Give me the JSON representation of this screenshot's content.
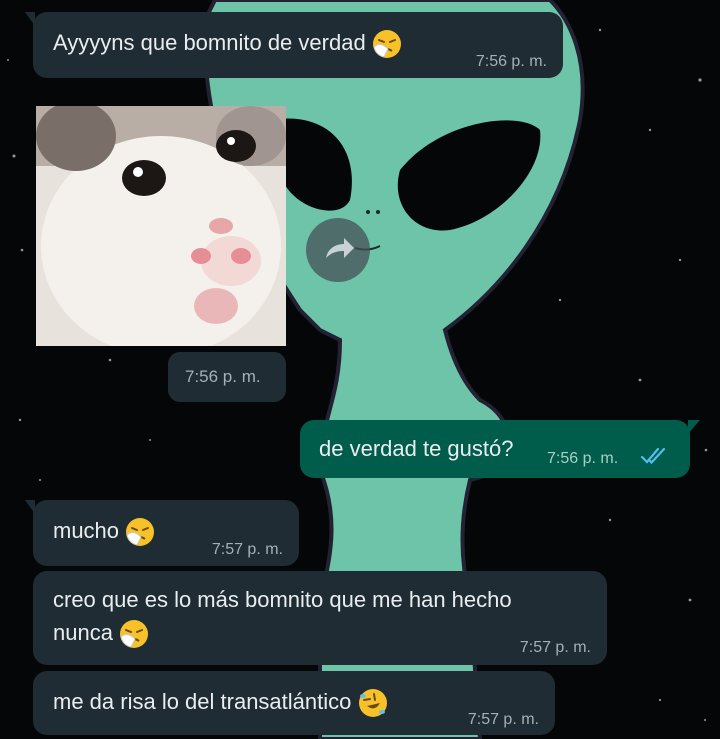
{
  "messages": [
    {
      "text": "Ayyyyns que bomnito de verdad",
      "time": "7:56 p. m.",
      "emoji": "sneezing-face"
    },
    {
      "image": "crying-cat-sticker",
      "time": "7:56 p. m."
    },
    {
      "text": "de verdad te gustó?",
      "time": "7:56 p. m.",
      "status": "read-double-check"
    },
    {
      "text": "mucho",
      "time": "7:57 p. m.",
      "emoji": "sneezing-face"
    },
    {
      "line1": "creo que es lo más bomnito que me han hecho",
      "line2": "nunca",
      "time": "7:57 p. m.",
      "emoji": "sneezing-face"
    },
    {
      "text": "me da risa lo del transatlántico",
      "time": "7:57 p. m.",
      "emoji": "rolling-on-floor-laughing-face"
    }
  ],
  "colors": {
    "incoming_bubble": "#1f2c33",
    "outgoing_bubble": "#005c4b",
    "read_check": "#53bdeb",
    "wallpaper_alien": "#6ec4a8",
    "wallpaper_bg": "#050607"
  }
}
